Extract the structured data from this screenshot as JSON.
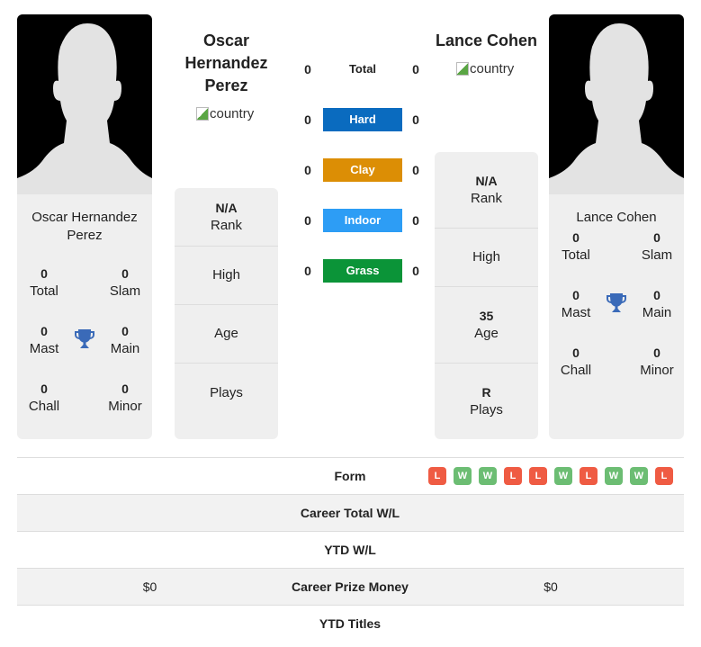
{
  "players": {
    "left": {
      "name": "Oscar Hernandez Perez",
      "name_lines": [
        "Oscar",
        "Hernandez",
        "Perez"
      ],
      "card_name": "Oscar Hernandez Perez",
      "country_alt": "country",
      "titles": {
        "total": {
          "value": "0",
          "label": "Total"
        },
        "slam": {
          "value": "0",
          "label": "Slam"
        },
        "mast": {
          "value": "0",
          "label": "Mast"
        },
        "main": {
          "value": "0",
          "label": "Main"
        },
        "chall": {
          "value": "0",
          "label": "Chall"
        },
        "minor": {
          "value": "0",
          "label": "Minor"
        }
      },
      "info": {
        "rank": {
          "value": "N/A",
          "label": "Rank"
        },
        "high": {
          "value": "",
          "label": "High"
        },
        "age": {
          "value": "",
          "label": "Age"
        },
        "plays": {
          "value": "",
          "label": "Plays"
        }
      },
      "prize_money": "$0"
    },
    "right": {
      "name": "Lance Cohen",
      "card_name": "Lance Cohen",
      "country_alt": "country",
      "titles": {
        "total": {
          "value": "0",
          "label": "Total"
        },
        "slam": {
          "value": "0",
          "label": "Slam"
        },
        "mast": {
          "value": "0",
          "label": "Mast"
        },
        "main": {
          "value": "0",
          "label": "Main"
        },
        "chall": {
          "value": "0",
          "label": "Chall"
        },
        "minor": {
          "value": "0",
          "label": "Minor"
        }
      },
      "info": {
        "rank": {
          "value": "N/A",
          "label": "Rank"
        },
        "high": {
          "value": "",
          "label": "High"
        },
        "age": {
          "value": "35",
          "label": "Age"
        },
        "plays": {
          "value": "R",
          "label": "Plays"
        }
      },
      "prize_money": "$0"
    }
  },
  "surfaces": [
    {
      "label": "Total",
      "left": "0",
      "right": "0",
      "color": ""
    },
    {
      "label": "Hard",
      "left": "0",
      "right": "0",
      "color": "#0a6bbf"
    },
    {
      "label": "Clay",
      "left": "0",
      "right": "0",
      "color": "#dc8e05"
    },
    {
      "label": "Indoor",
      "left": "0",
      "right": "0",
      "color": "#2d9df5"
    },
    {
      "label": "Grass",
      "left": "0",
      "right": "0",
      "color": "#0b9438"
    }
  ],
  "form": {
    "label": "Form",
    "results": [
      "L",
      "W",
      "W",
      "L",
      "L",
      "W",
      "L",
      "W",
      "W",
      "L"
    ],
    "colors": {
      "W": "#6cbd73",
      "L": "#ef5b43"
    }
  },
  "table": [
    {
      "label": "Career Total W/L",
      "left": "",
      "right": ""
    },
    {
      "label": "YTD W/L",
      "left": "",
      "right": ""
    },
    {
      "label": "Career Prize Money",
      "left": "$0",
      "right": "$0"
    },
    {
      "label": "YTD Titles",
      "left": "",
      "right": ""
    }
  ],
  "trophy_color": "#3a6ab8"
}
